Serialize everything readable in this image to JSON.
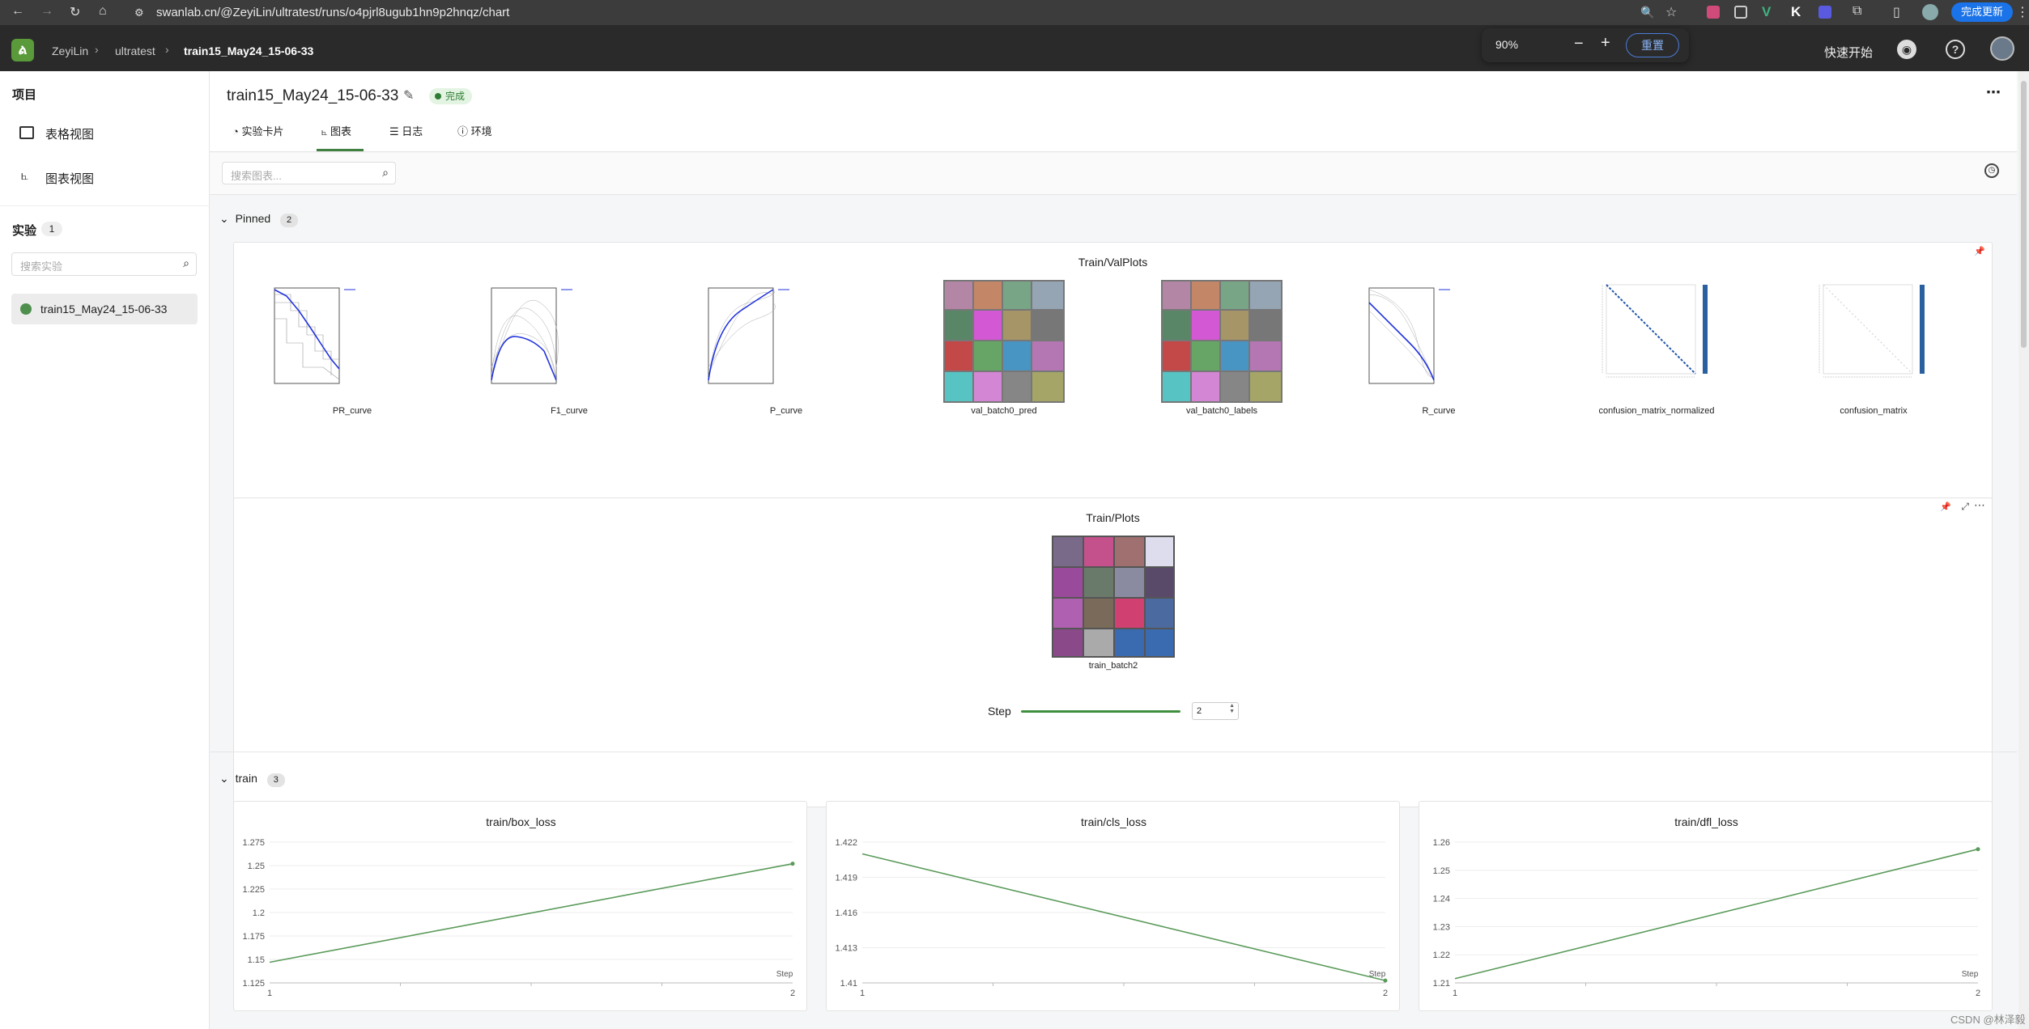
{
  "browser": {
    "url": "swanlab.cn/@ZeyiLin/ultratest/runs/o4pjrl8ugub1hn9p2hnqz/chart",
    "update_button": "完成更新",
    "zoom": {
      "level": "90%",
      "minus": "−",
      "plus": "+",
      "reset": "重置"
    }
  },
  "header": {
    "breadcrumb": [
      "ZeyiLin",
      "ultratest",
      "train15_May24_15-06-33"
    ],
    "quick_start": "快速开始"
  },
  "sidebar": {
    "project_title": "项目",
    "views": [
      "表格视图",
      "图表视图"
    ],
    "experiments_title": "实验",
    "experiments_count": "1",
    "search_placeholder": "搜索实验",
    "experiment_item": "train15_May24_15-06-33"
  },
  "run": {
    "title": "train15_May24_15-06-33",
    "status": "完成",
    "tabs": [
      "实验卡片",
      "图表",
      "日志",
      "环境"
    ],
    "active_tab": "图表",
    "chart_search_placeholder": "搜索图表..."
  },
  "pinned": {
    "label": "Pinned",
    "count": "2",
    "valplots": {
      "title": "Train/ValPlots",
      "images": [
        "PR_curve",
        "F1_curve",
        "P_curve",
        "val_batch0_pred",
        "val_batch0_labels",
        "R_curve",
        "confusion_matrix_normalized",
        "confusion_matrix"
      ]
    },
    "plots": {
      "title": "Train/Plots",
      "image": "train_batch2",
      "step_label": "Step",
      "step_value": "2"
    }
  },
  "train": {
    "label": "train",
    "count": "3"
  },
  "chart_data": [
    {
      "type": "line",
      "title": "train/box_loss",
      "xlabel": "Step",
      "x": [
        1,
        2
      ],
      "values": [
        1.147,
        1.252
      ],
      "ylim": [
        1.125,
        1.275
      ],
      "yticks": [
        "1.275",
        "1.25",
        "1.225",
        "1.2",
        "1.175",
        "1.15",
        "1.125"
      ],
      "xticks": [
        "1",
        "2"
      ],
      "color": "#5a9a5a"
    },
    {
      "type": "line",
      "title": "train/cls_loss",
      "xlabel": "Step",
      "x": [
        1,
        2
      ],
      "values": [
        1.421,
        1.4102
      ],
      "ylim": [
        1.41,
        1.422
      ],
      "yticks": [
        "1.422",
        "1.419",
        "1.416",
        "1.413",
        "1.41"
      ],
      "xticks": [
        "1",
        "2"
      ],
      "color": "#5a9a5a"
    },
    {
      "type": "line",
      "title": "train/dfl_loss",
      "xlabel": "Step",
      "x": [
        1,
        2
      ],
      "values": [
        1.2115,
        1.2575
      ],
      "ylim": [
        1.21,
        1.26
      ],
      "yticks": [
        "1.26",
        "1.25",
        "1.24",
        "1.23",
        "1.22",
        "1.21"
      ],
      "xticks": [
        "1",
        "2"
      ],
      "color": "#5a9a5a"
    }
  ],
  "watermark": "CSDN @林泽毅"
}
